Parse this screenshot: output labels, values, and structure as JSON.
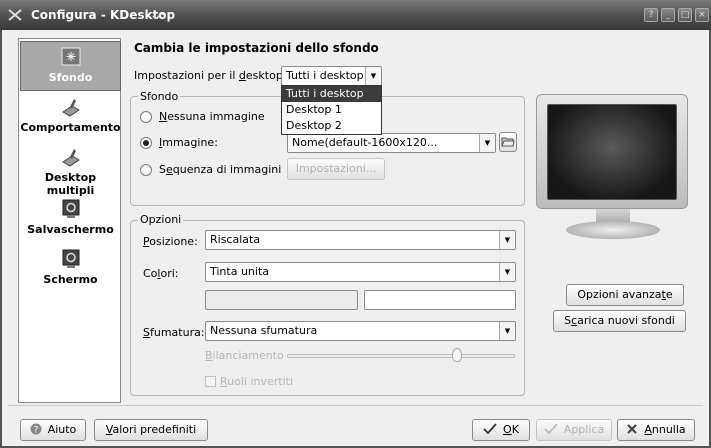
{
  "window": {
    "title": "Configura - KDesktop"
  },
  "titlebar_buttons": [
    "?",
    "_",
    "□",
    "×"
  ],
  "sidebar": {
    "items": [
      {
        "label": "Sfondo",
        "icon": "wallpaper-icon",
        "selected": true
      },
      {
        "label": "Comportamento",
        "icon": "desktop-behavior-icon",
        "selected": false
      },
      {
        "label": "Desktop multipli",
        "icon": "multiple-desktops-icon",
        "selected": false
      },
      {
        "label": "Salvaschermo",
        "icon": "screensaver-icon",
        "selected": false
      },
      {
        "label": "Schermo",
        "icon": "display-icon",
        "selected": false
      }
    ]
  },
  "main": {
    "heading": "Cambia le impostazioni dello sfondo",
    "desktop_setting": {
      "label_pre": "Impostazioni per il ",
      "label_key": "d",
      "label_post": "esktop:",
      "value": "Tutti i desktop",
      "options": [
        "Tutti i desktop",
        "Desktop 1",
        "Desktop 2"
      ]
    },
    "background_group": {
      "title": "Sfondo",
      "no_image": {
        "key": "N",
        "rest": "essuna immagine",
        "checked": false
      },
      "image": {
        "pre": "",
        "key": "I",
        "rest": "mmagine:",
        "checked": true,
        "value": "Nome(default-1600x120..."
      },
      "slideshow": {
        "pre": "S",
        "key": "e",
        "rest": "quenza di immagini",
        "checked": false,
        "settings_button": "Impostazioni..."
      }
    },
    "options_group": {
      "title": "Opzioni",
      "position": {
        "key": "P",
        "rest": "osizione:",
        "value": "Riscalata"
      },
      "colors": {
        "pre": "Co",
        "key": "l",
        "rest": "ori:",
        "value": "Tinta unita"
      },
      "blending": {
        "key": "S",
        "rest": "fumatura:",
        "value": "Nessuna sfumatura"
      },
      "balance": {
        "key": "B",
        "rest": "ilanciamento",
        "value": 0.75
      },
      "reverse_roles": {
        "key": "R",
        "rest": "uoli invertiti",
        "checked": false
      }
    },
    "advanced_button": {
      "pre": "Opzioni avanza",
      "key": "t",
      "rest": "e"
    },
    "download_button": {
      "pre": "S",
      "key": "c",
      "rest": "arica nuovi sfondi"
    }
  },
  "footer": {
    "help": {
      "label": "Aiuto"
    },
    "defaults": {
      "key": "V",
      "rest": "alori predefiniti"
    },
    "ok": {
      "key": "O",
      "rest": "K"
    },
    "apply": {
      "label": "Applica"
    },
    "cancel": {
      "key": "A",
      "rest": "nnulla"
    }
  }
}
